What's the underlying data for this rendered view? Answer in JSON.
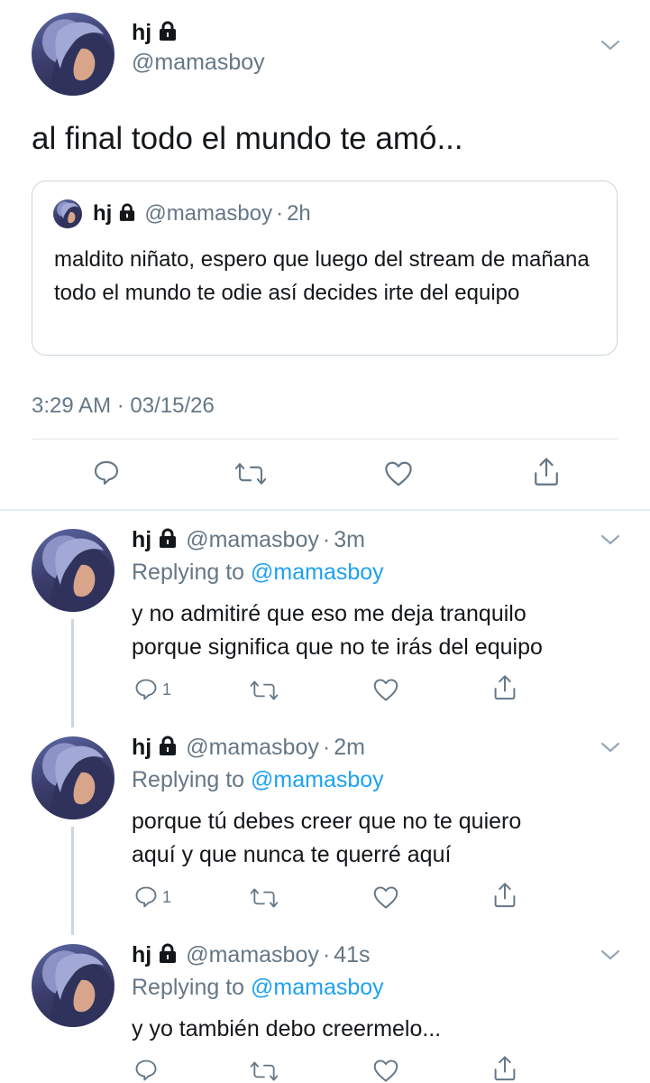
{
  "main_tweet": {
    "name": "hj",
    "handle": "@mamasboy",
    "text": "al final todo el mundo te amó...",
    "quoted": {
      "name": "hj",
      "handle": "@mamasboy",
      "sep": "·",
      "time": "2h",
      "text": "maldito niñato, espero que luego del stream de mañana todo el mundo te odie así decides irte del equipo"
    },
    "timestamp": "3:29 AM · 03/15/26"
  },
  "replies": [
    {
      "name": "hj",
      "handle": "@mamasboy",
      "sep": "·",
      "time": "3m",
      "replying_prefix": "Replying to",
      "replying_to": "@mamasboy",
      "text_line1": "y no admitiré que eso me deja tranquilo",
      "text_line2": "porque significa que no te irás del equipo",
      "reply_count": "1"
    },
    {
      "name": "hj",
      "handle": "@mamasboy",
      "sep": "·",
      "time": "2m",
      "replying_prefix": "Replying to",
      "replying_to": "@mamasboy",
      "text_line1": "porque tú debes creer que no te quiero",
      "text_line2": "aquí y que nunca te querré aquí",
      "reply_count": "1"
    },
    {
      "name": "hj",
      "handle": "@mamasboy",
      "sep": "·",
      "time": "41s",
      "replying_prefix": "Replying to",
      "replying_to": "@mamasboy",
      "text_line1": "y yo también debo creermelo...",
      "text_line2": "",
      "reply_count": ""
    }
  ],
  "icons": {
    "reply": "reply-icon",
    "retweet": "retweet-icon",
    "like": "heart-icon",
    "share": "share-icon",
    "lock": "lock-icon",
    "more": "chevron-down-icon"
  },
  "colors": {
    "link": "#1da1f2",
    "muted": "#657786",
    "text": "#14171a",
    "divider": "#e1e8ed"
  }
}
